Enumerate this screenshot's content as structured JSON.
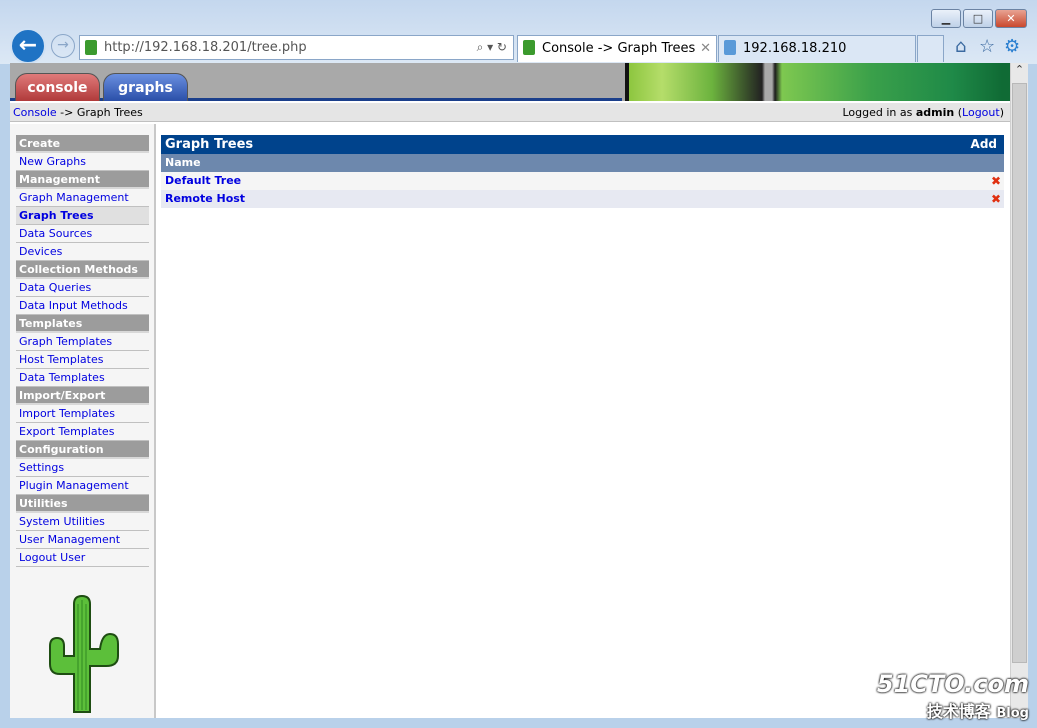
{
  "browser": {
    "url": "http://192.168.18.201/tree.php",
    "tabs": [
      {
        "label": "Console -> Graph Trees",
        "active": true
      },
      {
        "label": "192.168.18.210",
        "active": false
      }
    ]
  },
  "nav": {
    "console": "console",
    "graphs": "graphs"
  },
  "breadcrumb": {
    "root": "Console",
    "sep": " -> ",
    "current": "Graph Trees",
    "logged_prefix": "Logged in as ",
    "user": "admin",
    "logout": "Logout"
  },
  "sidebar": [
    {
      "label": "Create",
      "type": "header"
    },
    {
      "label": "New Graphs"
    },
    {
      "label": "Management",
      "type": "header"
    },
    {
      "label": "Graph Management"
    },
    {
      "label": "Graph Trees",
      "selected": true
    },
    {
      "label": "Data Sources"
    },
    {
      "label": "Devices"
    },
    {
      "label": "Collection Methods",
      "type": "header"
    },
    {
      "label": "Data Queries"
    },
    {
      "label": "Data Input Methods"
    },
    {
      "label": "Templates",
      "type": "header"
    },
    {
      "label": "Graph Templates"
    },
    {
      "label": "Host Templates"
    },
    {
      "label": "Data Templates"
    },
    {
      "label": "Import/Export",
      "type": "header"
    },
    {
      "label": "Import Templates"
    },
    {
      "label": "Export Templates"
    },
    {
      "label": "Configuration",
      "type": "header"
    },
    {
      "label": "Settings"
    },
    {
      "label": "Plugin Management"
    },
    {
      "label": "Utilities",
      "type": "header"
    },
    {
      "label": "System Utilities"
    },
    {
      "label": "User Management"
    },
    {
      "label": "Logout User"
    }
  ],
  "main": {
    "title": "Graph Trees",
    "add": "Add",
    "column": "Name",
    "rows": [
      "Default Tree",
      "Remote Host"
    ]
  },
  "watermark": {
    "line1": "51CTO.com",
    "line2": "技术博客",
    "line3": "Blog"
  },
  "colors": {
    "header": "#00438c",
    "column_header": "#6d88ad",
    "link": "#0000e0",
    "delete": "#e03010"
  }
}
